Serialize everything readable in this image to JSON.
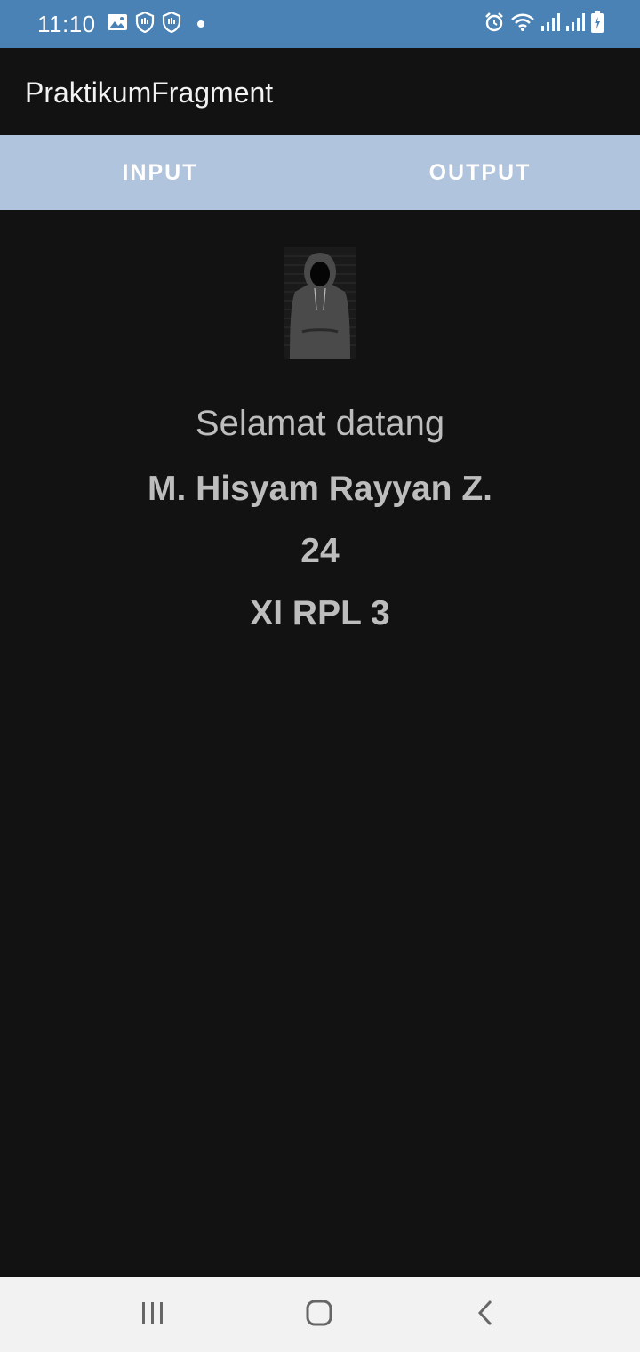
{
  "status_bar": {
    "time": "11:10",
    "left_icons": [
      "gallery-icon",
      "shield-hand-icon",
      "shield-hand-icon",
      "notification-dot-icon"
    ],
    "right_icons": [
      "alarm-icon",
      "wifi-icon",
      "signal-icon",
      "signal-icon",
      "battery-charging-icon"
    ],
    "background": "#4a82b6"
  },
  "app_bar": {
    "title": "PraktikumFragment"
  },
  "tabs": [
    {
      "label": "INPUT"
    },
    {
      "label": "OUTPUT"
    }
  ],
  "tab_bar_color": "#b0c4de",
  "output": {
    "greeting": "Selamat datang",
    "name": "M. Hisyam Rayyan Z.",
    "age": "24",
    "class": "XI RPL 3"
  },
  "nav_bar": {
    "buttons": [
      "recents-icon",
      "home-icon",
      "back-icon"
    ]
  }
}
